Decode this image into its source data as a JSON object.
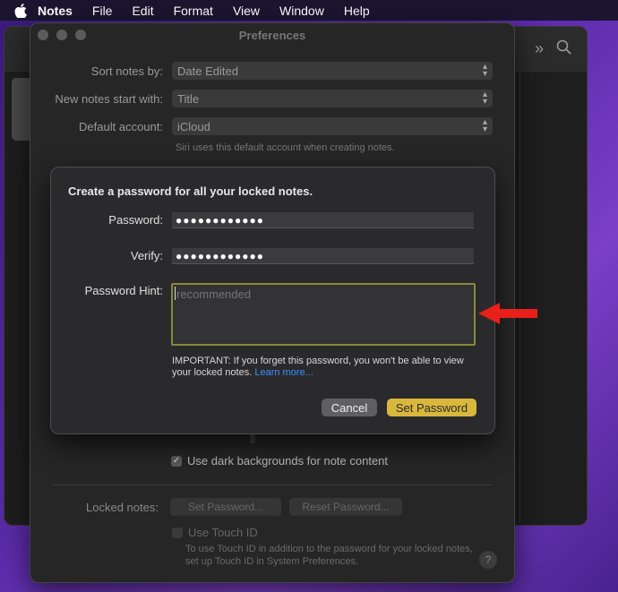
{
  "menubar": {
    "items": [
      "Notes",
      "File",
      "Edit",
      "Format",
      "View",
      "Window",
      "Help"
    ]
  },
  "preferences": {
    "title": "Preferences",
    "sort_label": "Sort notes by:",
    "sort_value": "Date Edited",
    "newnotes_label": "New notes start with:",
    "newnotes_value": "Title",
    "account_label": "Default account:",
    "account_value": "iCloud",
    "siri_note": "Siri uses this default account when creating notes.",
    "dark_bg_label": "Use dark backgrounds for note content",
    "locked_label": "Locked notes:",
    "set_password_btn": "Set Password...",
    "reset_password_btn": "Reset Password...",
    "touch_id_label": "Use Touch ID",
    "touch_id_note": "To use Touch ID in addition to the password for your locked notes, set up Touch ID in System Preferences.",
    "help": "?"
  },
  "sheet": {
    "heading": "Create a password for all your locked notes.",
    "password_label": "Password:",
    "password_value": "●●●●●●●●●●●●",
    "verify_label": "Verify:",
    "verify_value": "●●●●●●●●●●●●",
    "hint_label": "Password Hint:",
    "hint_placeholder": "recommended",
    "important_text": "IMPORTANT: If you forget this password, you won't be able to view your locked notes.",
    "learn_more": "Learn more...",
    "cancel": "Cancel",
    "set_password": "Set Password"
  },
  "colors": {
    "accent_button": "#d9b73c",
    "hint_border": "#8a8a3a",
    "arrow": "#e8201a",
    "link": "#3a8eff"
  }
}
